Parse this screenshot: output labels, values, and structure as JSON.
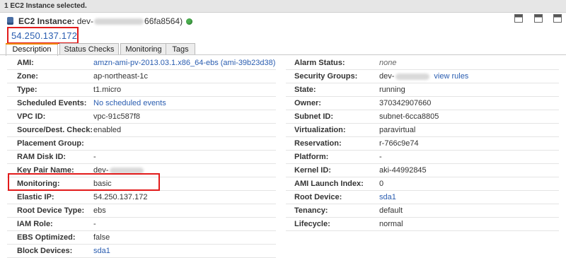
{
  "topbar": {
    "text": "1 EC2 Instance selected."
  },
  "header": {
    "title_bold": "EC2 Instance:",
    "name_prefix": "dev-",
    "name_suffix": "66fa8564)",
    "public_ip": "54.250.137.172"
  },
  "tabs": [
    {
      "label": "Description",
      "active": true
    },
    {
      "label": "Status Checks",
      "active": false
    },
    {
      "label": "Monitoring",
      "active": false
    },
    {
      "label": "Tags",
      "active": false
    }
  ],
  "left_props": [
    {
      "key": "AMI:",
      "value": "amzn-ami-pv-2013.03.1.x86_64-ebs (ami-39b23d38)",
      "style": "link"
    },
    {
      "key": "Zone:",
      "value": "ap-northeast-1c",
      "style": "plain"
    },
    {
      "key": "Type:",
      "value": "t1.micro",
      "style": "plain"
    },
    {
      "key": "Scheduled Events:",
      "value": "No scheduled events",
      "style": "link"
    },
    {
      "key": "VPC ID:",
      "value": "vpc-91c587f8",
      "style": "plain"
    },
    {
      "key": "Source/Dest. Check:",
      "value": "enabled",
      "style": "plain"
    },
    {
      "key": "Placement Group:",
      "value": "",
      "style": "plain"
    },
    {
      "key": "RAM Disk ID:",
      "value": "-",
      "style": "plain"
    },
    {
      "key": "Key Pair Name:",
      "value": "dev-",
      "style": "blurred"
    },
    {
      "key": "Monitoring:",
      "value": "basic",
      "style": "plain"
    },
    {
      "key": "Elastic IP:",
      "value": "54.250.137.172",
      "style": "plain"
    },
    {
      "key": "Root Device Type:",
      "value": "ebs",
      "style": "plain"
    },
    {
      "key": "IAM Role:",
      "value": "-",
      "style": "plain"
    },
    {
      "key": "EBS Optimized:",
      "value": "false",
      "style": "plain"
    },
    {
      "key": "Block Devices:",
      "value": "sda1",
      "style": "link"
    }
  ],
  "right_props": [
    {
      "key": "Alarm Status:",
      "value": "none",
      "style": "muted"
    },
    {
      "key": "Security Groups:",
      "value": "dev-",
      "extra": "view rules",
      "style": "blurred-link"
    },
    {
      "key": "State:",
      "value": "running",
      "style": "plain"
    },
    {
      "key": "Owner:",
      "value": "370342907660",
      "style": "plain"
    },
    {
      "key": "Subnet ID:",
      "value": "subnet-6cca8805",
      "style": "plain"
    },
    {
      "key": "Virtualization:",
      "value": "paravirtual",
      "style": "plain"
    },
    {
      "key": "Reservation:",
      "value": "r-766c9e74",
      "style": "plain"
    },
    {
      "key": "Platform:",
      "value": "-",
      "style": "plain"
    },
    {
      "key": "Kernel ID:",
      "value": "aki-44992845",
      "style": "plain"
    },
    {
      "key": "AMI Launch Index:",
      "value": "0",
      "style": "plain"
    },
    {
      "key": "Root Device:",
      "value": "sda1",
      "style": "link"
    },
    {
      "key": "Tenancy:",
      "value": "default",
      "style": "plain"
    },
    {
      "key": "Lifecycle:",
      "value": "normal",
      "style": "plain"
    }
  ],
  "colors": {
    "highlight": "#e21b1b",
    "link": "#2a5db0",
    "status_ok": "#4caf50",
    "tab_accent": "#f08a00"
  }
}
